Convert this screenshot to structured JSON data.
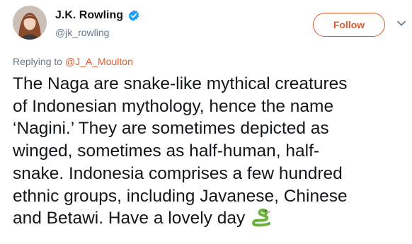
{
  "author": {
    "display_name": "J.K. Rowling",
    "handle": "@jk_rowling",
    "verified_icon": "verified-badge-icon",
    "avatar_icon": "profile-photo"
  },
  "actions": {
    "follow_label": "Follow",
    "more_icon": "chevron-down-icon"
  },
  "reply": {
    "prefix": "Replying to ",
    "mention": "@J_A_Moulton"
  },
  "tweet": {
    "text": "The Naga are snake-like mythical creatures\nof Indonesian mythology, hence the name\n‘Nagini.’ They are sometimes depicted as\nwinged, sometimes as half-human, half-\nsnake. Indonesia comprises a few hundred\nethnic groups, including Javanese, Chinese\nand Betawi. Have a lovely day",
    "emoji_icon": "snake-emoji-icon"
  },
  "colors": {
    "accent": "#e0592a",
    "verified": "#1da1f2",
    "secondary_text": "#657786",
    "primary_text": "#14171a"
  }
}
